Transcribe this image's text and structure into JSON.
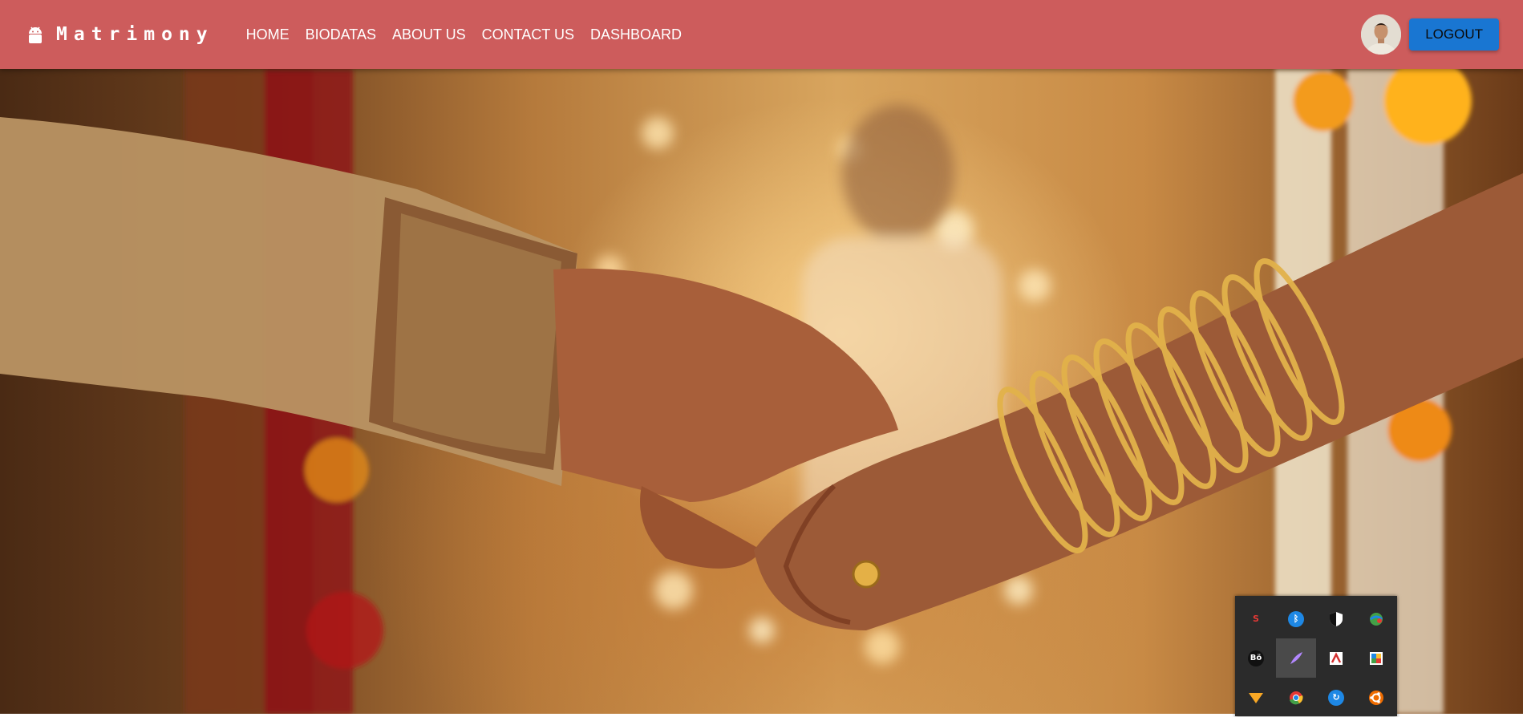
{
  "brand": {
    "name": "Matrimony",
    "icon": "android-icon"
  },
  "nav": [
    "HOME",
    "BIODATAS",
    "ABOUT US",
    "CONTACT US",
    "DASHBOARD"
  ],
  "user": {
    "logout_label": "LOGOUT"
  },
  "colors": {
    "appbar": "#cd5c5c",
    "logout_button": "#1976d2",
    "tray_bg": "#2b2b2b"
  },
  "tray_icons": [
    "sync-app-icon",
    "bluetooth-icon",
    "security-shield-icon",
    "network-globe-icon",
    "audio-app-icon",
    "pen-feather-icon",
    "acrobat-icon",
    "photos-icon",
    "vlc-cone-icon",
    "chrome-icon",
    "refresh-app-icon",
    "ubuntu-icon"
  ]
}
